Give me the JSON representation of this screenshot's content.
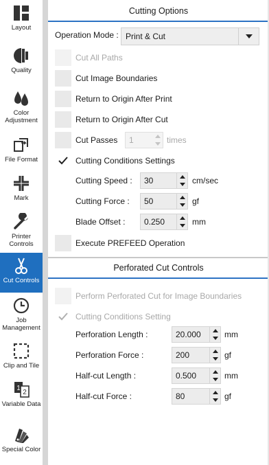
{
  "sidebar": {
    "items": [
      {
        "label": "Layout",
        "icon": "layout-icon"
      },
      {
        "label": "Quality",
        "icon": "quality-icon"
      },
      {
        "label": "Color Adjustment",
        "icon": "color-adjustment-icon"
      },
      {
        "label": "File Format",
        "icon": "file-format-icon"
      },
      {
        "label": "Mark",
        "icon": "mark-icon"
      },
      {
        "label": "Printer Controls",
        "icon": "printer-controls-icon"
      },
      {
        "label": "Cut Controls",
        "icon": "cut-controls-icon"
      },
      {
        "label": "Job Management",
        "icon": "job-management-icon"
      },
      {
        "label": "Clip and Tile",
        "icon": "clip-and-tile-icon"
      },
      {
        "label": "Variable Data",
        "icon": "variable-data-icon"
      },
      {
        "label": "Special Color",
        "icon": "special-color-icon"
      }
    ],
    "active_index": 6,
    "accent_color": "#1f6fbf"
  },
  "cutting_options": {
    "title": "Cutting Options",
    "operation_mode_label": "Operation Mode :",
    "operation_mode_value": "Print & Cut",
    "cut_all_paths": {
      "label": "Cut All Paths",
      "checked": false,
      "enabled": false
    },
    "cut_image_boundaries": {
      "label": "Cut Image Boundaries",
      "checked": false
    },
    "return_after_print": {
      "label": "Return to Origin After Print",
      "checked": false
    },
    "return_after_cut": {
      "label": "Return to Origin After Cut",
      "checked": false
    },
    "cut_passes": {
      "label": "Cut Passes",
      "value": "1",
      "unit": "times",
      "checked": false
    },
    "cutting_conditions": {
      "label": "Cutting Conditions Settings",
      "checked": true
    },
    "cutting_speed": {
      "label": "Cutting Speed :",
      "value": "30",
      "unit": "cm/sec"
    },
    "cutting_force": {
      "label": "Cutting Force :",
      "value": "50",
      "unit": "gf"
    },
    "blade_offset": {
      "label": "Blade Offset :",
      "value": "0.250",
      "unit": "mm"
    },
    "execute_prefeed": {
      "label": "Execute PREFEED Operation",
      "checked": false
    }
  },
  "perforated": {
    "title": "Perforated Cut Controls",
    "perform_perforated": {
      "label": "Perform Perforated Cut for Image Boundaries",
      "checked": false,
      "enabled": false
    },
    "conditions_setting": {
      "label": "Cutting Conditions Setting",
      "checked": true,
      "enabled": false
    },
    "perforation_length": {
      "label": "Perforation Length :",
      "value": "20.000",
      "unit": "mm"
    },
    "perforation_force": {
      "label": "Perforation Force :",
      "value": "200",
      "unit": "gf"
    },
    "halfcut_length": {
      "label": "Half-cut Length :",
      "value": "0.500",
      "unit": "mm"
    },
    "halfcut_force": {
      "label": "Half-cut Force :",
      "value": "80",
      "unit": "gf"
    }
  }
}
